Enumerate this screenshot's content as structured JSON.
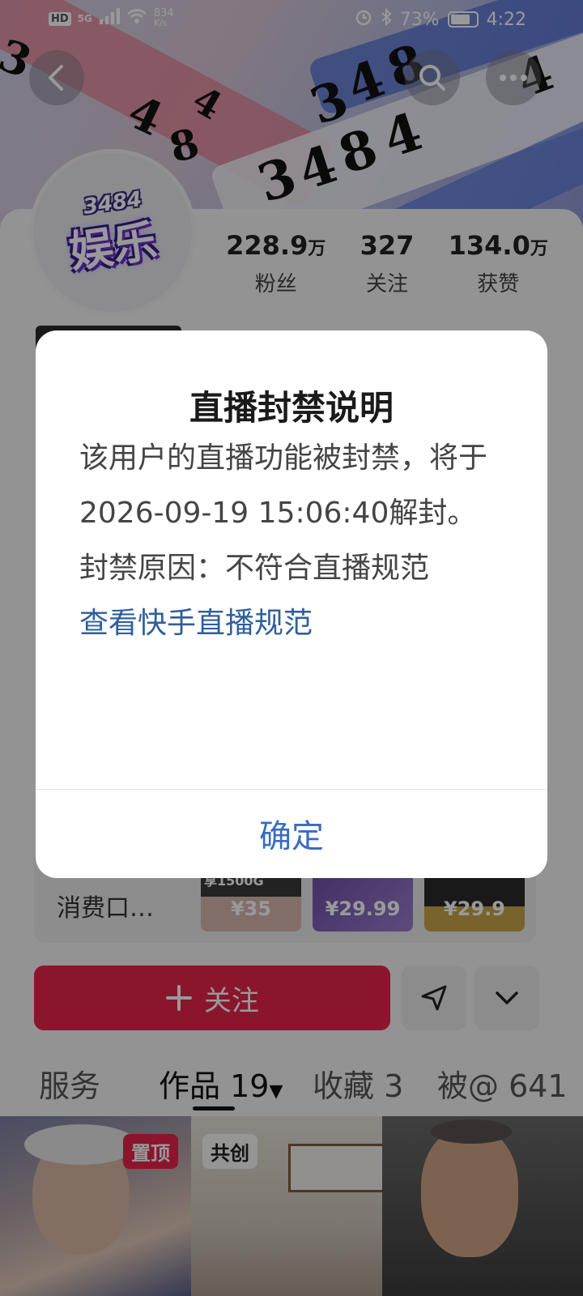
{
  "status_bar": {
    "hd": "HD",
    "network": "5G",
    "speed_value": "834",
    "speed_unit": "K/s",
    "battery": "73%",
    "time": "4:22"
  },
  "header": {
    "back_icon": "chevron-left-icon",
    "search_icon": "search-icon",
    "more_icon": "more-dots-icon",
    "background_digits": [
      "3",
      "4",
      "8",
      "4",
      "3",
      "4",
      "8",
      "4",
      "3",
      "4",
      "8",
      "4"
    ]
  },
  "profile": {
    "avatar_logo_top": "3484",
    "avatar_logo_main": "娱乐",
    "stats": [
      {
        "value": "228.9",
        "unit": "万",
        "label": "粉丝"
      },
      {
        "value": "327",
        "unit": "",
        "label": "关注"
      },
      {
        "value": "134.0",
        "unit": "万",
        "label": "获赞"
      }
    ]
  },
  "shop": {
    "label": "消费口…",
    "items": [
      {
        "price": "¥35",
        "caption": "享1500G"
      },
      {
        "price": "¥29.99"
      },
      {
        "price": "¥29.9"
      }
    ]
  },
  "actions": {
    "follow_label": "关注",
    "share_icon": "send-icon",
    "expand_icon": "chevron-down-icon"
  },
  "tabs": [
    {
      "label": "服务"
    },
    {
      "label": "作品 19"
    },
    {
      "label": "收藏 3"
    },
    {
      "label": "被@ 641"
    }
  ],
  "thumbnails": [
    {
      "badge": "置顶"
    },
    {
      "badge": "共创"
    },
    {
      "badge": ""
    }
  ],
  "dialog": {
    "title": "直播封禁说明",
    "line1": "该用户的直播功能被封禁，将于2026-09-19 15:06:40解封。",
    "line2": "封禁原因：不符合直播规范",
    "link": "查看快手直播规范",
    "confirm": "确定"
  },
  "colors": {
    "follow_button": "#e8244a",
    "link": "#2f5e9c",
    "confirm": "#3a6bc0"
  }
}
